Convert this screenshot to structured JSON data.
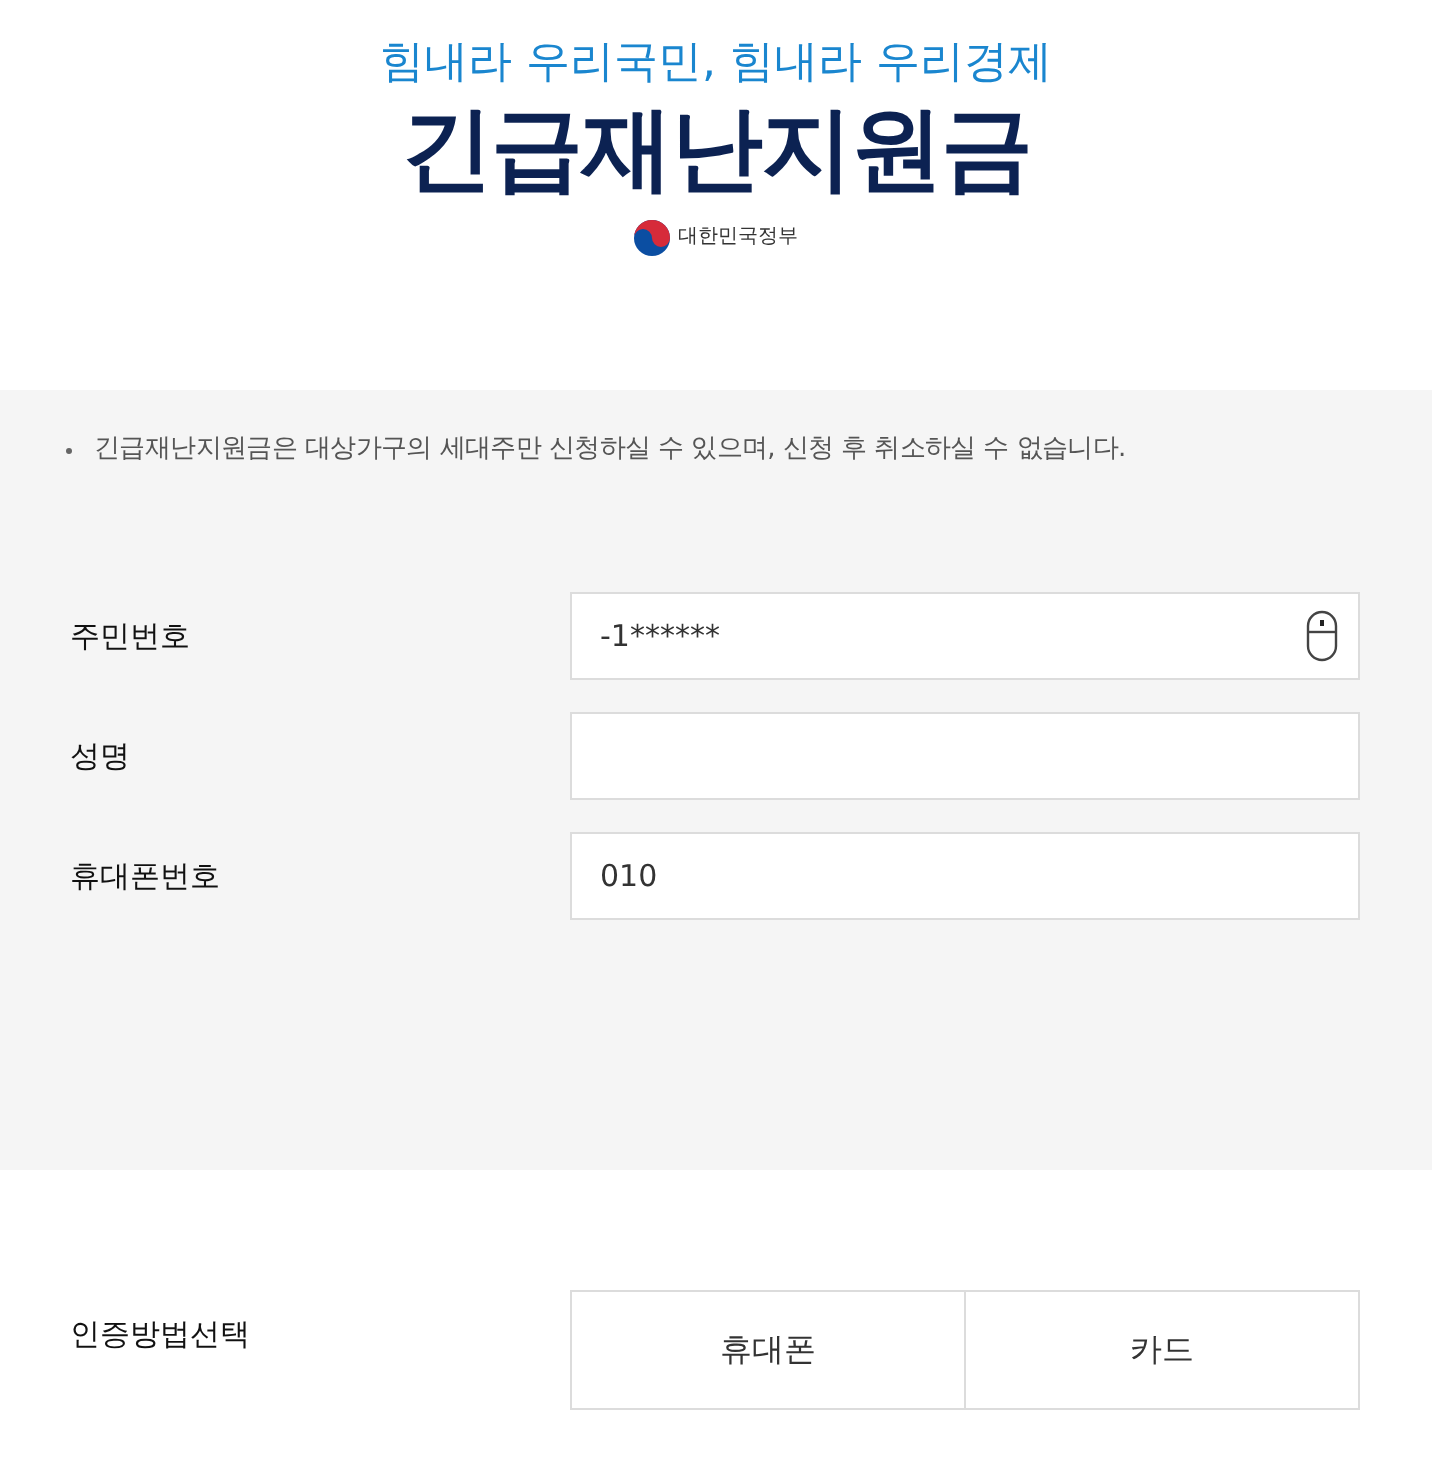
{
  "header": {
    "slogan": "힘내라 우리국민, 힘내라 우리경제",
    "title": "긴급재난지원금",
    "government": "대한민국정부"
  },
  "notices": [
    "긴급재난지원금은 대상가구의 세대주만 신청하실 수 있으며, 신청 후 취소하실 수 없습니다."
  ],
  "fields": [
    {
      "label": "주민번호",
      "value": "-1******",
      "kind": "mouse_input"
    },
    {
      "label": "성명",
      "kind": "text"
    },
    {
      "label": "휴대폰번호",
      "value": "010",
      "kind": "text"
    }
  ],
  "auth": {
    "label": "인증방법선택",
    "options": [
      {
        "label": "휴대폰",
        "selected": false
      },
      {
        "label": "카드",
        "selected": false
      }
    ]
  }
}
